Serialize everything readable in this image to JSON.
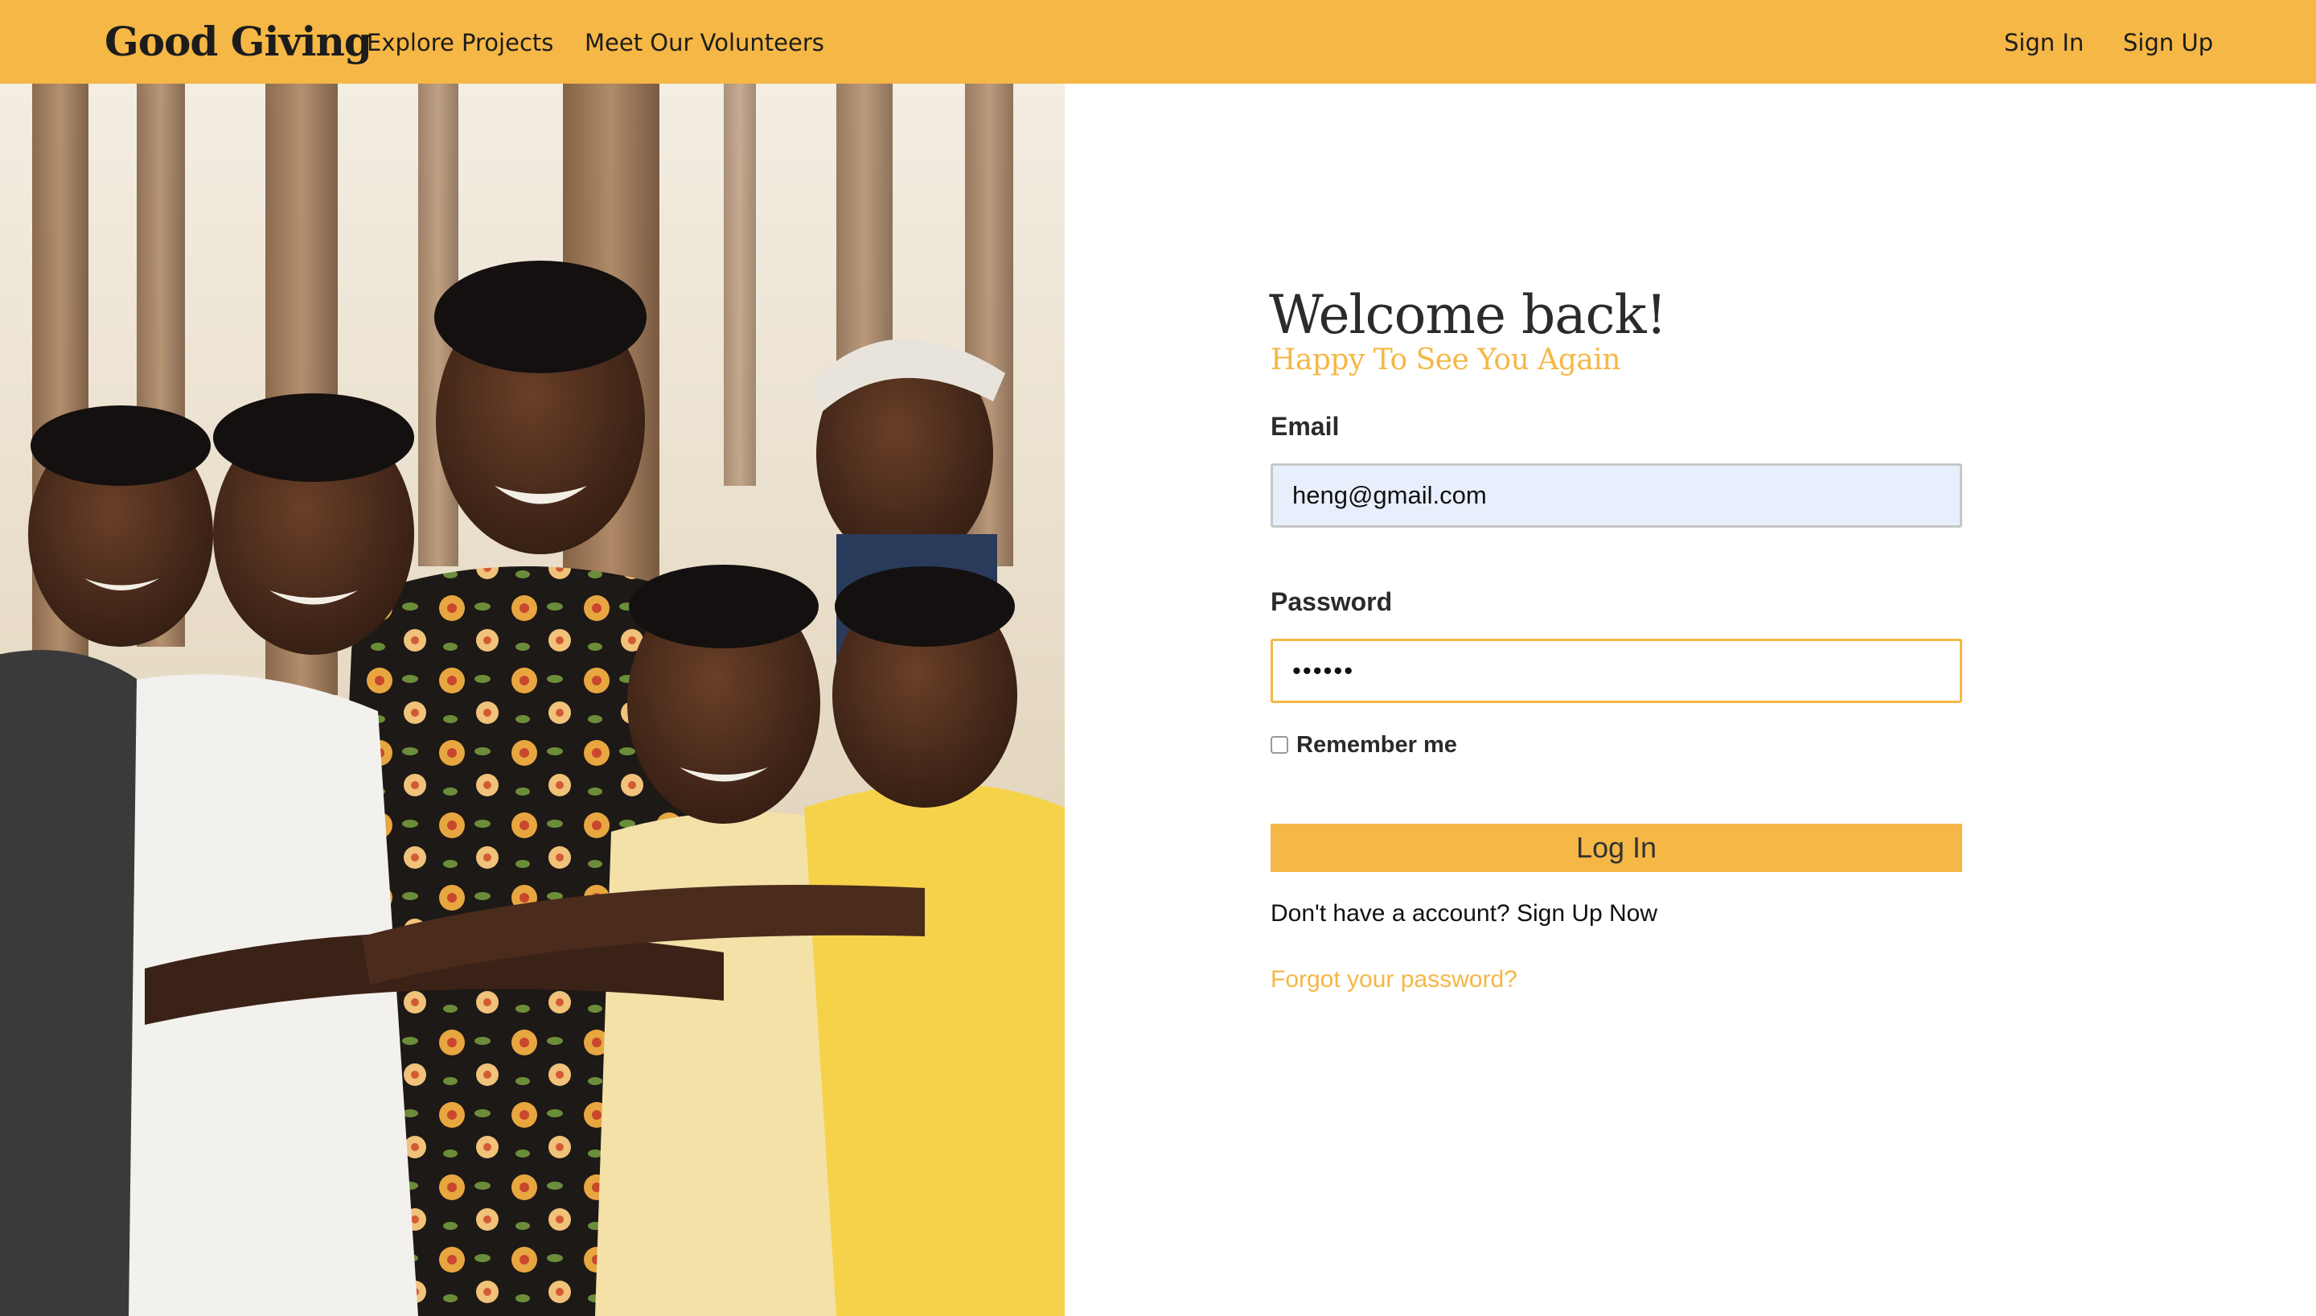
{
  "nav": {
    "brand": "Good Giving",
    "links": [
      "Explore Projects",
      "Meet Our Volunteers"
    ],
    "auth": [
      "Sign In",
      "Sign Up"
    ]
  },
  "hero": {
    "image": "smiling-group-photo"
  },
  "login": {
    "title": "Welcome back!",
    "subtitle": "Happy To See You Again",
    "email_label": "Email",
    "email_value": "heng@gmail.com",
    "password_label": "Password",
    "password_value": "••••••",
    "remember_label": "Remember me",
    "remember_checked": false,
    "submit_label": "Log In",
    "no_account_text": "Don't have a account?",
    "signup_link": "Sign Up Now",
    "forgot_link": "Forgot your password?"
  },
  "colors": {
    "brand": "#f5b745",
    "text": "#2b2b2b",
    "email_bg": "#e8effc"
  }
}
